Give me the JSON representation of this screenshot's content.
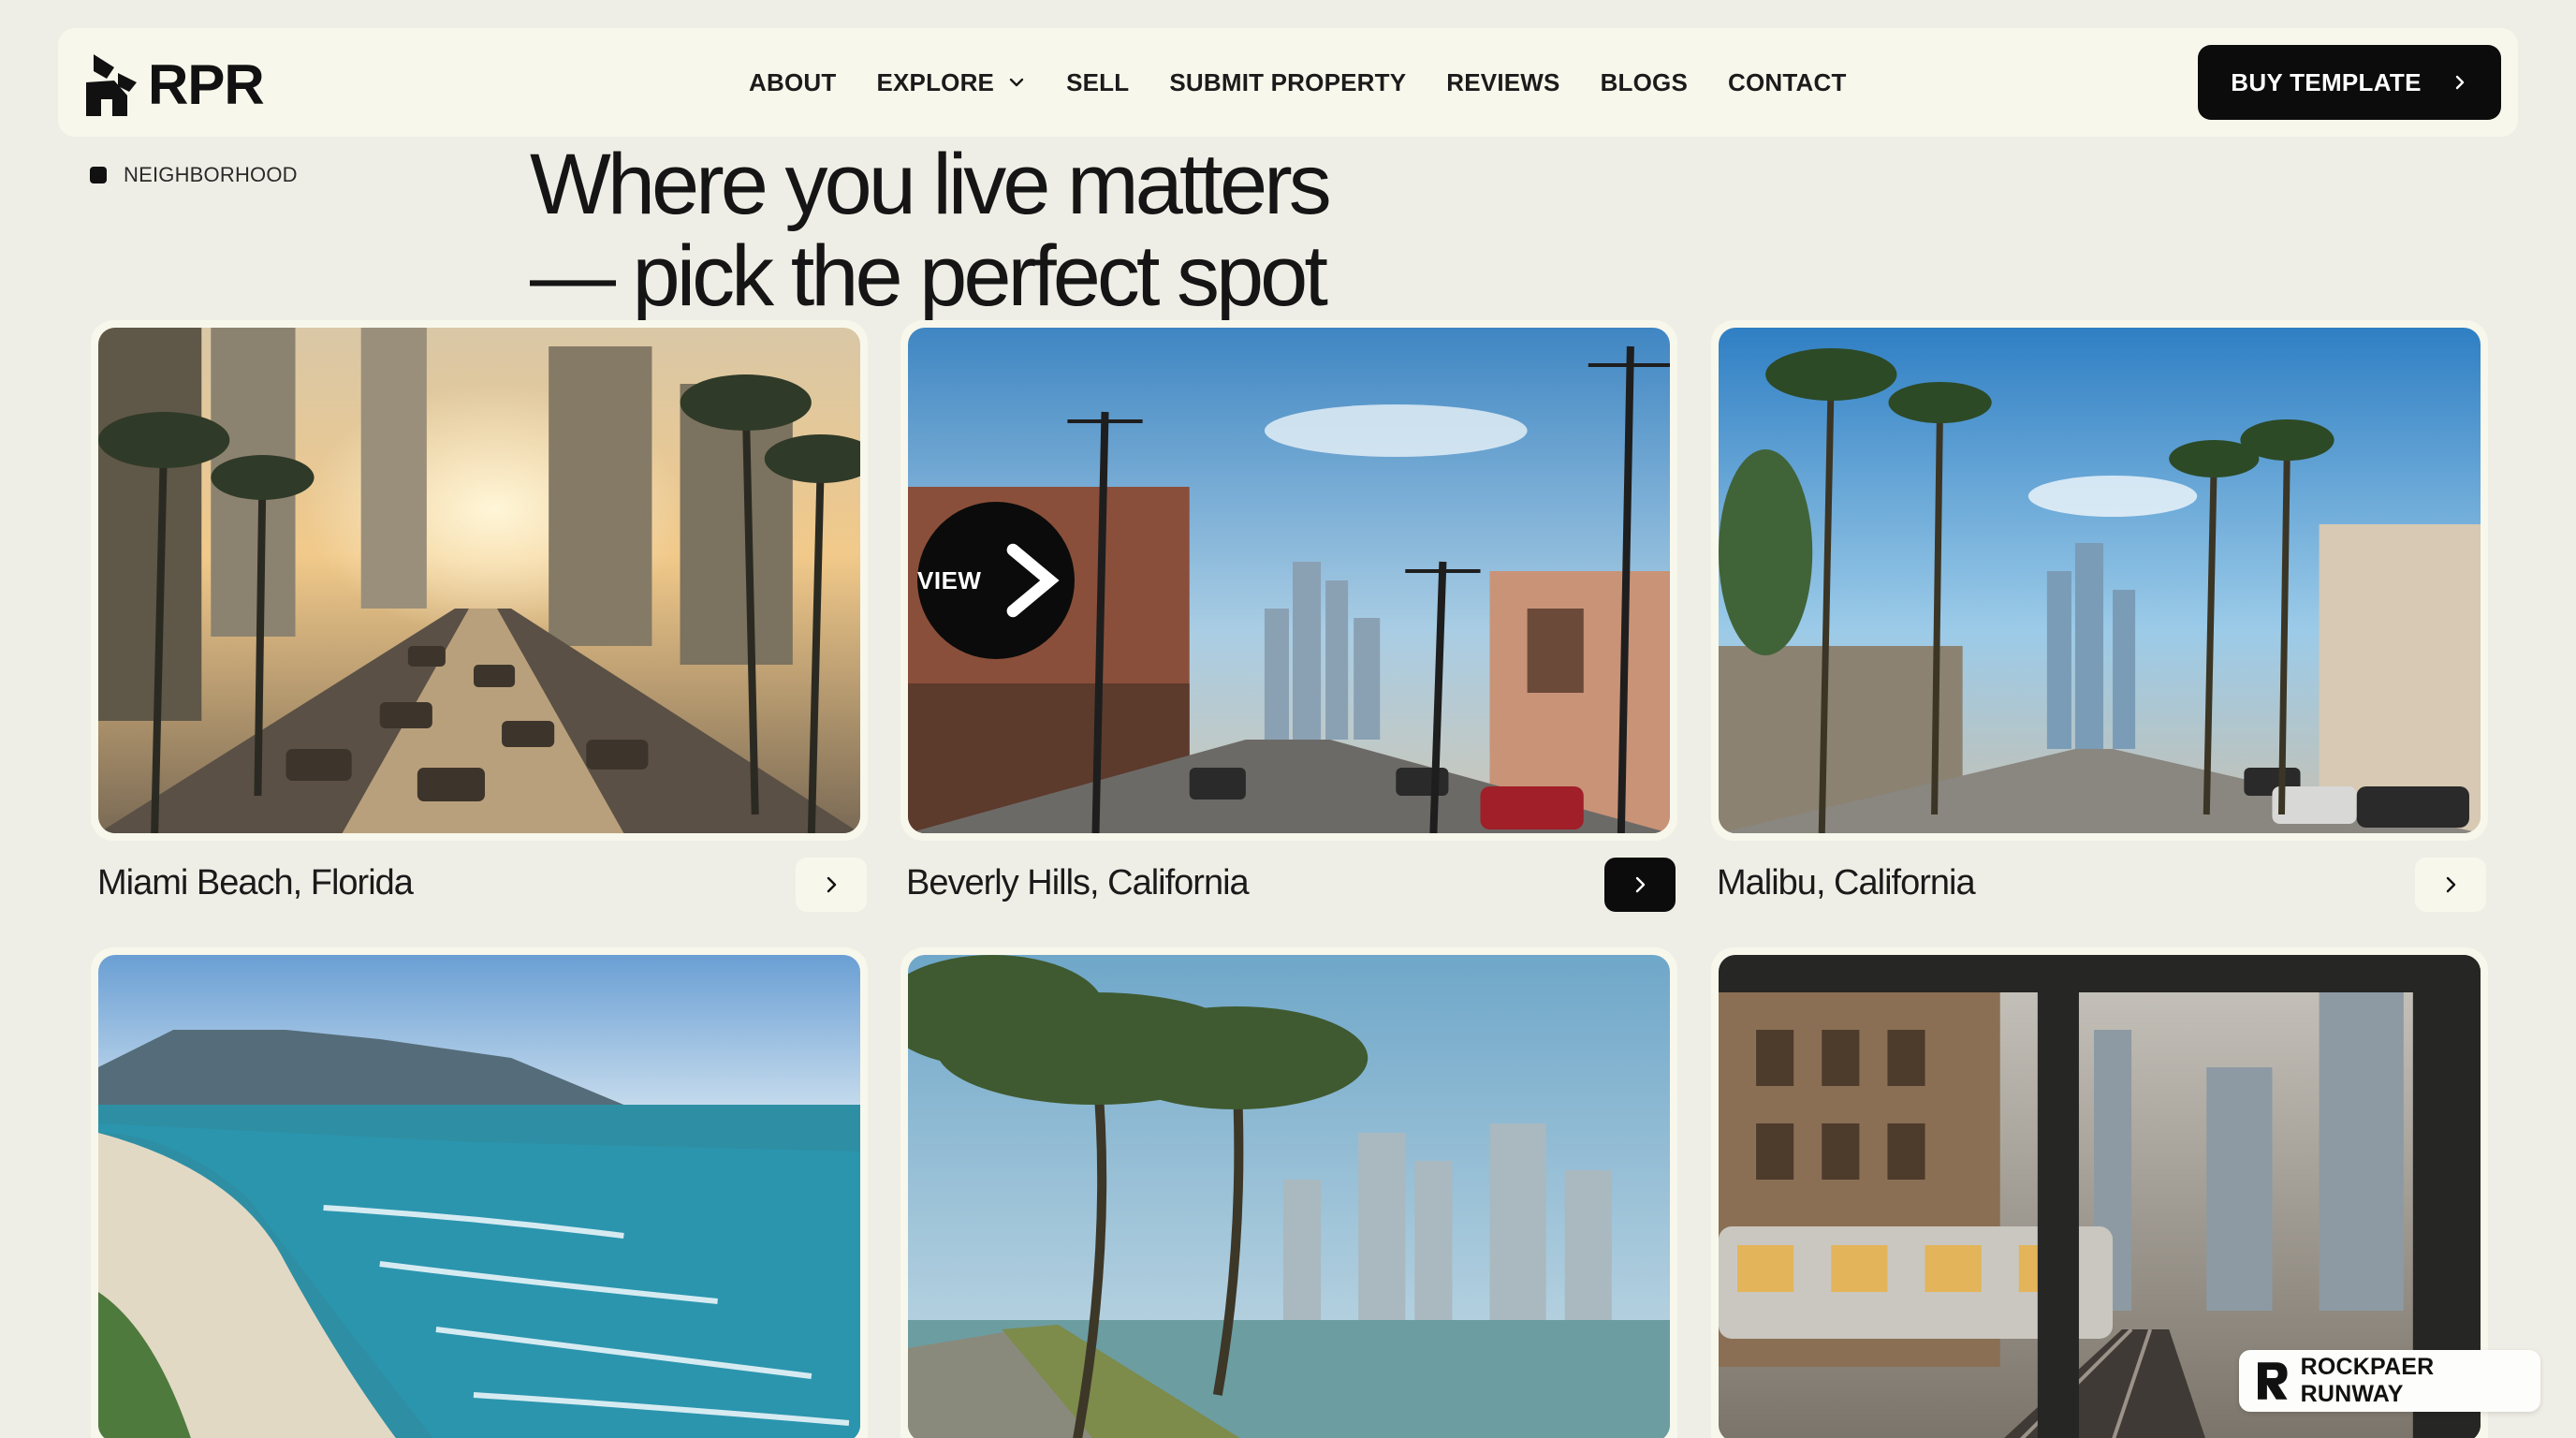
{
  "brand": {
    "name": "RPR"
  },
  "nav": {
    "items": [
      {
        "label": "ABOUT"
      },
      {
        "label": "EXPLORE",
        "has_dropdown": true
      },
      {
        "label": "SELL"
      },
      {
        "label": "SUBMIT PROPERTY"
      },
      {
        "label": "REVIEWS"
      },
      {
        "label": "BLOGS"
      },
      {
        "label": "CONTACT"
      }
    ],
    "cta": "BUY TEMPLATE"
  },
  "section": {
    "tag": "NEIGHBORHOOD",
    "headline_line1": "Where you live matters",
    "headline_line2": "— pick the perfect spot"
  },
  "cards": [
    {
      "title": "Miami Beach, Florida",
      "image": "city-traffic-sunset"
    },
    {
      "title": "Beverly Hills, California",
      "image": "street-power-lines",
      "hover_badge": "VIEW"
    },
    {
      "title": "Malibu, California",
      "image": "palm-avenue-skyline"
    },
    {
      "image": "coastal-beach-mountains"
    },
    {
      "image": "palms-waterfront-towers"
    },
    {
      "image": "train-city-street"
    }
  ],
  "badge": {
    "label": "ROCKPAER RUNWAY"
  },
  "colors": {
    "background": "#efeee6",
    "surface": "#f8f7ec",
    "dark": "#0c0c0c"
  }
}
